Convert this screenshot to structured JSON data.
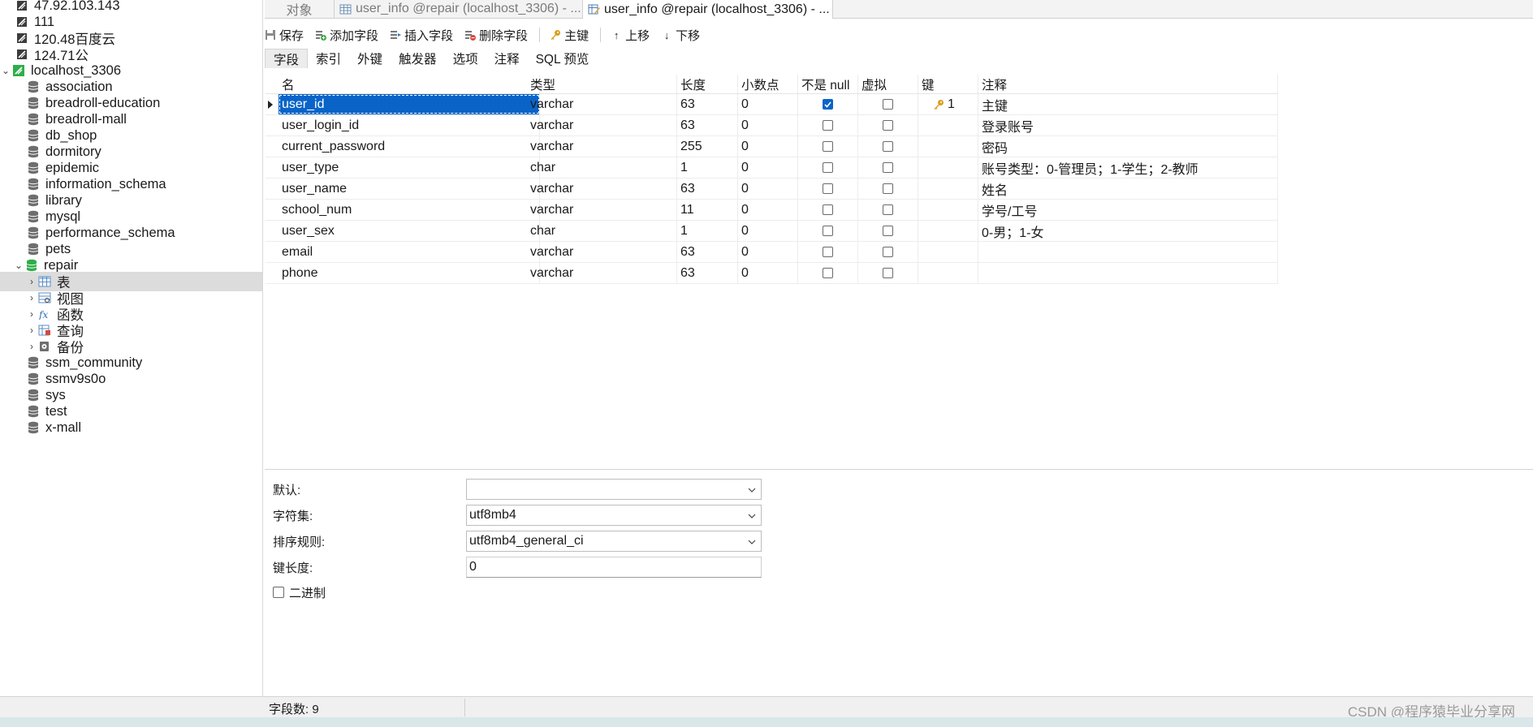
{
  "sidebar": {
    "connections_top": [
      {
        "label": "47.92.103.143"
      },
      {
        "label": "111"
      },
      {
        "label": "120.48百度云"
      },
      {
        "label": "124.71公"
      }
    ],
    "connection": {
      "label": "localhost_3306"
    },
    "databases_before": [
      {
        "label": "association"
      },
      {
        "label": "breadroll-education"
      },
      {
        "label": "breadroll-mall"
      },
      {
        "label": "db_shop"
      },
      {
        "label": "dormitory"
      },
      {
        "label": "epidemic"
      },
      {
        "label": "information_schema"
      },
      {
        "label": "library"
      },
      {
        "label": "mysql"
      },
      {
        "label": "performance_schema"
      },
      {
        "label": "pets"
      }
    ],
    "open_db": {
      "label": "repair"
    },
    "children": [
      {
        "label": "表"
      },
      {
        "label": "视图"
      },
      {
        "label": "函数"
      },
      {
        "label": "查询"
      },
      {
        "label": "备份"
      }
    ],
    "databases_after": [
      {
        "label": "ssm_community"
      },
      {
        "label": "ssmv9s0o"
      },
      {
        "label": "sys"
      },
      {
        "label": "test"
      },
      {
        "label": "x-mall"
      }
    ]
  },
  "tabs": [
    {
      "label": "对象"
    },
    {
      "label": "user_info @repair (localhost_3306) - ..."
    },
    {
      "label": "user_info @repair (localhost_3306) - ..."
    }
  ],
  "toolbar": {
    "save": "保存",
    "add_field": "添加字段",
    "insert_field": "插入字段",
    "delete_field": "删除字段",
    "primary_key": "主键",
    "move_up": "上移",
    "move_down": "下移"
  },
  "subtabs": [
    "字段",
    "索引",
    "外键",
    "触发器",
    "选项",
    "注释",
    "SQL 预览"
  ],
  "grid": {
    "headers": {
      "name": "名",
      "type": "类型",
      "length": "长度",
      "decimals": "小数点",
      "not_null": "不是 null",
      "virtual": "虚拟",
      "key": "键",
      "comment": "注释"
    },
    "rows": [
      {
        "name": "user_id",
        "type": "varchar",
        "length": "63",
        "decimals": "0",
        "not_null": true,
        "virtual": false,
        "key": "1",
        "comment": "主键"
      },
      {
        "name": "user_login_id",
        "type": "varchar",
        "length": "63",
        "decimals": "0",
        "not_null": false,
        "virtual": false,
        "key": "",
        "comment": "登录账号"
      },
      {
        "name": "current_password",
        "type": "varchar",
        "length": "255",
        "decimals": "0",
        "not_null": false,
        "virtual": false,
        "key": "",
        "comment": "密码"
      },
      {
        "name": "user_type",
        "type": "char",
        "length": "1",
        "decimals": "0",
        "not_null": false,
        "virtual": false,
        "key": "",
        "comment": "账号类型：0-管理员；1-学生；2-教师"
      },
      {
        "name": "user_name",
        "type": "varchar",
        "length": "63",
        "decimals": "0",
        "not_null": false,
        "virtual": false,
        "key": "",
        "comment": "姓名"
      },
      {
        "name": "school_num",
        "type": "varchar",
        "length": "11",
        "decimals": "0",
        "not_null": false,
        "virtual": false,
        "key": "",
        "comment": "学号/工号"
      },
      {
        "name": "user_sex",
        "type": "char",
        "length": "1",
        "decimals": "0",
        "not_null": false,
        "virtual": false,
        "key": "",
        "comment": "0-男；1-女"
      },
      {
        "name": "email",
        "type": "varchar",
        "length": "63",
        "decimals": "0",
        "not_null": false,
        "virtual": false,
        "key": "",
        "comment": ""
      },
      {
        "name": "phone",
        "type": "varchar",
        "length": "63",
        "decimals": "0",
        "not_null": false,
        "virtual": false,
        "key": "",
        "comment": ""
      }
    ]
  },
  "props": {
    "default_label": "默认:",
    "default_value": "",
    "charset_label": "字符集:",
    "charset_value": "utf8mb4",
    "collation_label": "排序规则:",
    "collation_value": "utf8mb4_general_ci",
    "key_length_label": "键长度:",
    "key_length_value": "0",
    "binary_label": "二进制",
    "binary_checked": false
  },
  "status": {
    "field_count": "字段数: 9",
    "watermark": "CSDN @程序猿毕业分享网"
  },
  "colors": {
    "selection": "#0a64c8",
    "db_icon": "#6e6e6e",
    "open_db_icon": "#2fae4a",
    "key_icon": "#d9a01b"
  }
}
